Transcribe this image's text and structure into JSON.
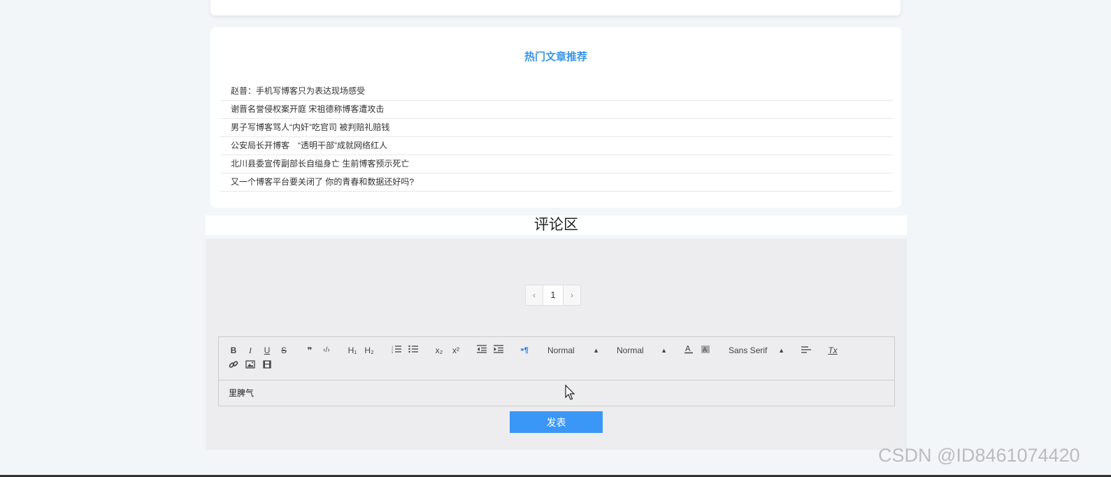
{
  "hot": {
    "title": "热门文章推荐",
    "items": [
      "赵普：手机写博客只为表达现场感受",
      "谢晋名誉侵权案开庭 宋祖德称博客遭攻击",
      "男子写博客骂人“内奸”吃官司 被判赔礼赔钱",
      "公安局长开博客　“透明干部”成就网络红人",
      "北川县委宣传副部长自缢身亡 生前博客预示死亡",
      "又一个博客平台要关闭了 你的青春和数据还好吗?"
    ]
  },
  "comments": {
    "title": "评论区",
    "pager": {
      "prev": "‹",
      "page": "1",
      "next": "›"
    },
    "toolbar": {
      "bold": "B",
      "italic": "I",
      "underline": "U",
      "strike": "S",
      "blockquote": "❞",
      "code": "‹/›",
      "h1": "H₁",
      "h2": "H₂",
      "sub": "x₂",
      "super": "x²",
      "direction": "⁍¶",
      "size_picker": "Normal",
      "header_picker": "Normal",
      "font_picker": "Sans Serif",
      "clean": "Tx"
    },
    "editor_text": "里脾气",
    "submit_label": "发表"
  },
  "watermark": "CSDN @ID8461074420",
  "colors": {
    "accent": "#3a97f7",
    "title": "#3a97e8",
    "panel": "#ededef"
  }
}
